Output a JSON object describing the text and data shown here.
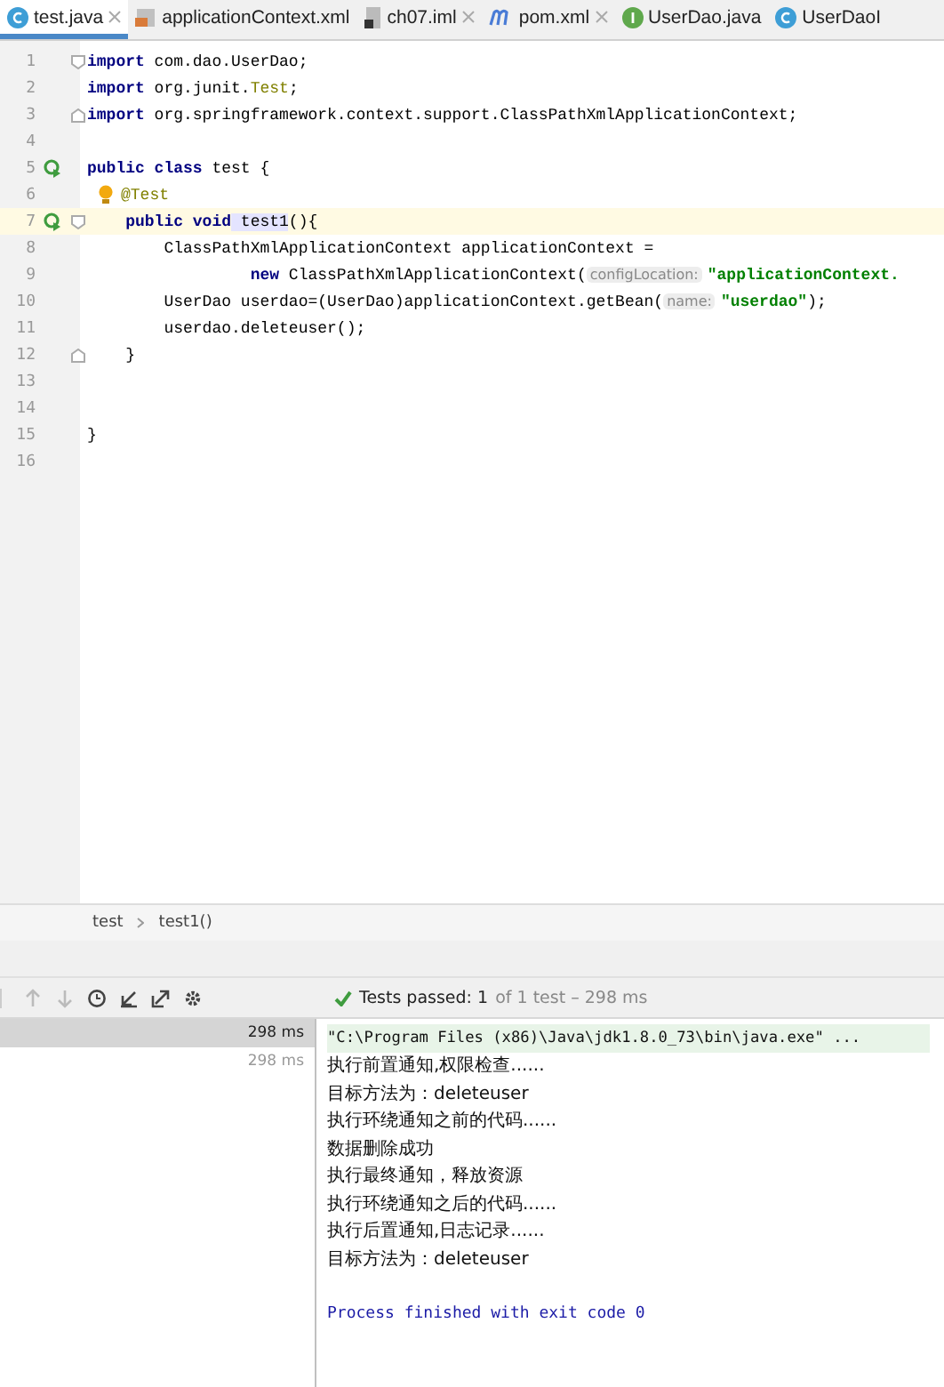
{
  "tabs": [
    {
      "label": "test.java",
      "kind": "class",
      "selected": true,
      "closable": true
    },
    {
      "label": "applicationContext.xml",
      "kind": "xml",
      "selected": false,
      "closable": false
    },
    {
      "label": "ch07.iml",
      "kind": "module",
      "selected": false,
      "closable": true
    },
    {
      "label": "pom.xml",
      "kind": "maven",
      "selected": false,
      "closable": true
    },
    {
      "label": "UserDao.java",
      "kind": "interface",
      "selected": false,
      "closable": false
    },
    {
      "label": "UserDaoI",
      "kind": "class",
      "selected": false,
      "closable": false
    }
  ],
  "editor": {
    "lines": [
      {
        "number": "1",
        "fold_start": true,
        "tokens": [
          {
            "kind": "keyword",
            "text": "import"
          },
          {
            "kind": "plain",
            "text": " com.dao.UserDao;"
          }
        ]
      },
      {
        "number": "2",
        "tokens": [
          {
            "kind": "keyword",
            "text": "import"
          },
          {
            "kind": "plain",
            "text": " org.junit."
          },
          {
            "kind": "type",
            "text": "Test"
          },
          {
            "kind": "plain",
            "text": ";"
          }
        ]
      },
      {
        "number": "3",
        "fold_end": true,
        "tokens": [
          {
            "kind": "keyword",
            "text": "import"
          },
          {
            "kind": "plain",
            "text": " org.springframework.context.support.ClassPathXmlApplicationContext;"
          }
        ]
      },
      {
        "number": "4"
      },
      {
        "number": "5",
        "run_marker": true,
        "tokens": [
          {
            "kind": "keyword",
            "text": "public class"
          },
          {
            "kind": "plain",
            "text": " test {"
          }
        ]
      },
      {
        "number": "6",
        "intention": true,
        "tokens": [
          {
            "kind": "annotation",
            "text": "@Test"
          }
        ]
      },
      {
        "number": "7",
        "run_marker": true,
        "fold_start": true,
        "current": true,
        "tokens": [
          {
            "kind": "keyword",
            "text": "    public void"
          },
          {
            "kind": "usage",
            "text": " test1"
          },
          {
            "kind": "plain",
            "text": "(){"
          }
        ]
      },
      {
        "number": "8",
        "tokens": [
          {
            "kind": "plain",
            "text": "        ClassPathXmlApplicationContext applicationContext ="
          }
        ]
      },
      {
        "number": "9",
        "tokens": [
          {
            "kind": "keyword",
            "text": "                 new"
          },
          {
            "kind": "plain",
            "text": " ClassPathXmlApplicationContext("
          },
          {
            "kind": "hint",
            "text": "configLocation:"
          },
          {
            "kind": "string",
            "text": "\"applicationContext."
          }
        ]
      },
      {
        "number": "10",
        "tokens": [
          {
            "kind": "plain",
            "text": "        UserDao userdao=(UserDao)applicationContext.getBean("
          },
          {
            "kind": "hint",
            "text": "name:"
          },
          {
            "kind": "string",
            "text": "\"userdao\""
          },
          {
            "kind": "plain",
            "text": ");"
          }
        ]
      },
      {
        "number": "11",
        "tokens": [
          {
            "kind": "plain",
            "text": "        userdao.deleteuser();"
          }
        ]
      },
      {
        "number": "12",
        "fold_end": true,
        "tokens": [
          {
            "kind": "plain",
            "text": "    }"
          }
        ]
      },
      {
        "number": "13"
      },
      {
        "number": "14"
      },
      {
        "number": "15",
        "tokens": [
          {
            "kind": "plain",
            "text": "}"
          }
        ]
      },
      {
        "number": "16"
      }
    ]
  },
  "breadcrumbs": [
    "test",
    "test1()"
  ],
  "run": {
    "toolbar": [
      {
        "kind": "up",
        "disabled": true
      },
      {
        "kind": "down",
        "disabled": true
      },
      {
        "kind": "history",
        "disabled": false
      },
      {
        "kind": "import",
        "disabled": false
      },
      {
        "kind": "export",
        "disabled": false
      },
      {
        "kind": "settings",
        "disabled": false
      }
    ],
    "status": {
      "passed": "Tests passed: 1",
      "detail": "of 1 test – 298 ms"
    },
    "tree": [
      {
        "time": "298 ms",
        "selected": true
      },
      {
        "time": "298 ms",
        "selected": false
      }
    ],
    "console": [
      {
        "kind": "command",
        "text": "\"C:\\Program Files (x86)\\Java\\jdk1.8.0_73\\bin\\java.exe\" ..."
      },
      {
        "kind": "output",
        "text": "执行前置通知,权限检查......"
      },
      {
        "kind": "output",
        "text": "目标方法为：deleteuser"
      },
      {
        "kind": "output",
        "text": "执行环绕通知之前的代码......"
      },
      {
        "kind": "output",
        "text": "数据删除成功"
      },
      {
        "kind": "output",
        "text": "执行最终通知，释放资源"
      },
      {
        "kind": "output",
        "text": "执行环绕通知之后的代码......"
      },
      {
        "kind": "output",
        "text": "执行后置通知,日志记录......"
      },
      {
        "kind": "output",
        "text": "目标方法为：deleteuser"
      },
      {
        "kind": "exit",
        "text": "Process finished with exit code 0"
      }
    ]
  }
}
